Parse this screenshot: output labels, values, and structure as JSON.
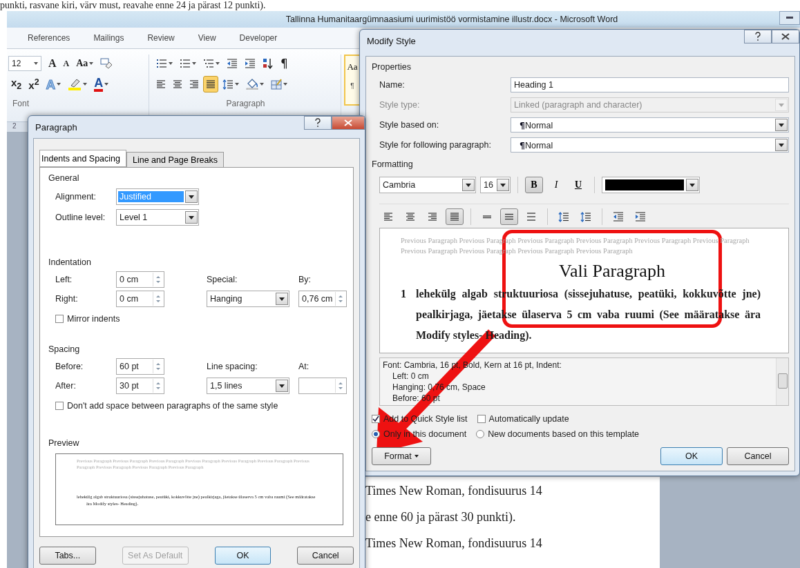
{
  "page_text_top": "punkti, rasvane kiri, värv must, reavahe enne 24 ja pärast 12 punkti).",
  "window": {
    "title": "Tallinna Humanitaargümnaasiumi uurimistöö vormistamine illustr.docx - Microsoft Word"
  },
  "ribbon": {
    "tabs": [
      {
        "label": "References",
        "selected": false
      },
      {
        "label": "Mailings",
        "selected": false
      },
      {
        "label": "Review",
        "selected": false
      },
      {
        "label": "View",
        "selected": false
      },
      {
        "label": "Developer",
        "selected": false
      }
    ],
    "font_size": "12",
    "font_top": [
      {
        "kind": "grow",
        "glyph": "A",
        "menu": false,
        "on": false
      },
      {
        "kind": "shrink",
        "glyph": "A",
        "menu": false,
        "on": false
      },
      {
        "kind": "case",
        "glyph": "Aa",
        "menu": true,
        "on": false
      },
      {
        "kind": "clear",
        "menu": false,
        "on": false
      }
    ],
    "font_bottom": [
      {
        "kind": "sub",
        "glyph": "x$_{2}$",
        "menu": false,
        "on": false
      },
      {
        "kind": "sup",
        "glyph": "x$^{2}$",
        "menu": false,
        "on": false
      },
      {
        "kind": "effects",
        "glyph": "A",
        "menu": true,
        "on": false
      },
      {
        "kind": "highlight",
        "menu": true,
        "on": false
      },
      {
        "kind": "font-color",
        "glyph": "A",
        "menu": true,
        "on": false
      }
    ],
    "para_top": [
      {
        "kind": "bullets",
        "menu": true,
        "on": false
      },
      {
        "kind": "numbering",
        "menu": true,
        "on": false
      },
      {
        "kind": "multilevel",
        "menu": true,
        "on": false
      },
      {
        "kind": "outdent",
        "menu": false,
        "on": false
      },
      {
        "kind": "indent",
        "menu": false,
        "on": false
      },
      {
        "kind": "sort",
        "menu": false,
        "on": false
      },
      {
        "kind": "pilcrow",
        "glyph": "¶",
        "menu": false,
        "on": false
      }
    ],
    "para_bottom": [
      {
        "kind": "align-left",
        "menu": false,
        "on": false
      },
      {
        "kind": "align-center",
        "menu": false,
        "on": false
      },
      {
        "kind": "align-right",
        "menu": false,
        "on": false
      },
      {
        "kind": "justify",
        "menu": false,
        "on": true
      },
      {
        "kind": "line-spacing",
        "menu": true,
        "on": false
      },
      {
        "kind": "shading",
        "menu": true,
        "on": false
      },
      {
        "kind": "borders",
        "menu": true,
        "on": false
      }
    ],
    "font_group": "Font",
    "paragraph_group": "Paragraph",
    "style_sample": "Aa",
    "style_mark": "¶"
  },
  "ruler_mark": "2",
  "document_lines": [
    "Times New Roman, fondisuurus 14",
    "e enne 60 ja pärast 30 punkti).",
    "Times New Roman, fondisuurus 14"
  ],
  "paragraph_dialog": {
    "title": "Paragraph",
    "tabs": [
      {
        "label": "Indents and Spacing",
        "selected": true
      },
      {
        "label": "Line and Page Breaks",
        "selected": false
      }
    ],
    "general": {
      "heading": "General",
      "alignment": {
        "label": "Alignment:",
        "value": "Justified",
        "text_selected": true
      },
      "outline": {
        "label": "Outline level:",
        "value": "Level 1"
      }
    },
    "indentation": {
      "heading": "Indentation",
      "left": {
        "label": "Left:",
        "value": "0 cm"
      },
      "right": {
        "label": "Right:",
        "value": "0 cm"
      },
      "special": {
        "label": "Special:",
        "value": "Hanging"
      },
      "by": {
        "label": "By:",
        "value": "0,76 cm"
      },
      "mirror": {
        "label": "Mirror indents",
        "checked": false
      }
    },
    "spacing": {
      "heading": "Spacing",
      "before": {
        "label": "Before:",
        "value": "60 pt"
      },
      "after": {
        "label": "After:",
        "value": "30 pt"
      },
      "line_spacing": {
        "label": "Line spacing:",
        "value": "1,5 lines"
      },
      "at": {
        "label": "At:"
      },
      "no_space": {
        "label": "Don't add space between paragraphs of the same style",
        "checked": false
      }
    },
    "preview": {
      "heading": "Preview",
      "previous_text": "Previous Paragraph Previous Paragraph Previous Paragraph Previous Paragraph Previous Paragraph Previous Paragraph Previous Paragraph Previous Paragraph Previous Paragraph Previous Paragraph",
      "sample_text": "lehekülg algab struktuuriosa (sissejuhatuse, peatüki, kokkuvõtte jne) pealkirjaga, jäetakse ülaserva 5 cm vaba ruumi (See määratakse ära Modify styles- Heading)."
    },
    "buttons": [
      {
        "label": "Tabs...",
        "disabled": false,
        "default": false
      },
      {
        "label": "Set As Default",
        "disabled": true,
        "default": false
      },
      {
        "label": "OK",
        "disabled": false,
        "default": true
      },
      {
        "label": "Cancel",
        "disabled": false,
        "default": false
      }
    ]
  },
  "modify_style": {
    "title": "Modify Style",
    "properties_heading": "Properties",
    "properties": [
      {
        "label": "Name:",
        "kind": "text",
        "value": "Heading 1",
        "disabled": false
      },
      {
        "label": "Style type:",
        "kind": "select",
        "value": "Linked (paragraph and character)",
        "disabled": true
      },
      {
        "label": "Style based on:",
        "kind": "select",
        "mark": "¶",
        "value": "Normal",
        "disabled": false
      },
      {
        "label": "Style for following paragraph:",
        "kind": "select",
        "mark": "¶",
        "value": "Normal",
        "disabled": false
      }
    ],
    "formatting_heading": "Formatting",
    "font": "Cambria",
    "size": "16",
    "styles": [
      {
        "kind": "bold",
        "glyph": "B",
        "on": true
      },
      {
        "kind": "italic",
        "glyph": "I",
        "on": false
      },
      {
        "kind": "underline",
        "glyph": "U",
        "on": false
      }
    ],
    "color": "#000000",
    "paragraph_tools": [
      {
        "kind": "align-left",
        "on": false
      },
      {
        "kind": "align-center",
        "on": false
      },
      {
        "kind": "align-right",
        "on": false
      },
      {
        "kind": "justify",
        "on": true
      },
      {
        "kind": "single-spacing",
        "on": false
      },
      {
        "kind": "onehalf-spacing",
        "on": true
      },
      {
        "kind": "double-spacing",
        "on": false
      },
      {
        "kind": "space-increase",
        "on": false
      },
      {
        "kind": "space-decrease",
        "on": false
      },
      {
        "kind": "outdent",
        "on": false
      },
      {
        "kind": "indent",
        "on": false
      }
    ],
    "preview": {
      "previous_text": "Previous Paragraph Previous Paragraph Previous Paragraph Previous Paragraph Previous Paragraph Previous Paragraph Previous Paragraph Previous Paragraph Previous Paragraph Previous Paragraph",
      "number": "1",
      "heading_text": "lehekülg algab struktuuriosa (sissejuhatuse, peatüki, kokkuvõtte jne) pealkirjaga, jäetakse ülaserva 5 cm vaba ruumi (See määratakse ära Modify styles- Heading)."
    },
    "description": [
      "Font: Cambria, 16 pt, Bold, Kern at 16 pt, Indent:",
      "Left:  0 cm",
      "Hanging:  0,76 cm, Space",
      "Before:  60 pt"
    ],
    "checkboxes": [
      {
        "label": "Add to Quick Style list",
        "checked": true
      },
      {
        "label": "Automatically update",
        "checked": false
      }
    ],
    "radios": [
      {
        "label": "Only in this document",
        "selected": true
      },
      {
        "label": "New documents based on this template",
        "selected": false
      }
    ],
    "format_button": "Format",
    "buttons": [
      {
        "label": "OK",
        "default": true
      },
      {
        "label": "Cancel",
        "default": false
      }
    ]
  },
  "annotation": {
    "label": "Vali Paragraph"
  }
}
